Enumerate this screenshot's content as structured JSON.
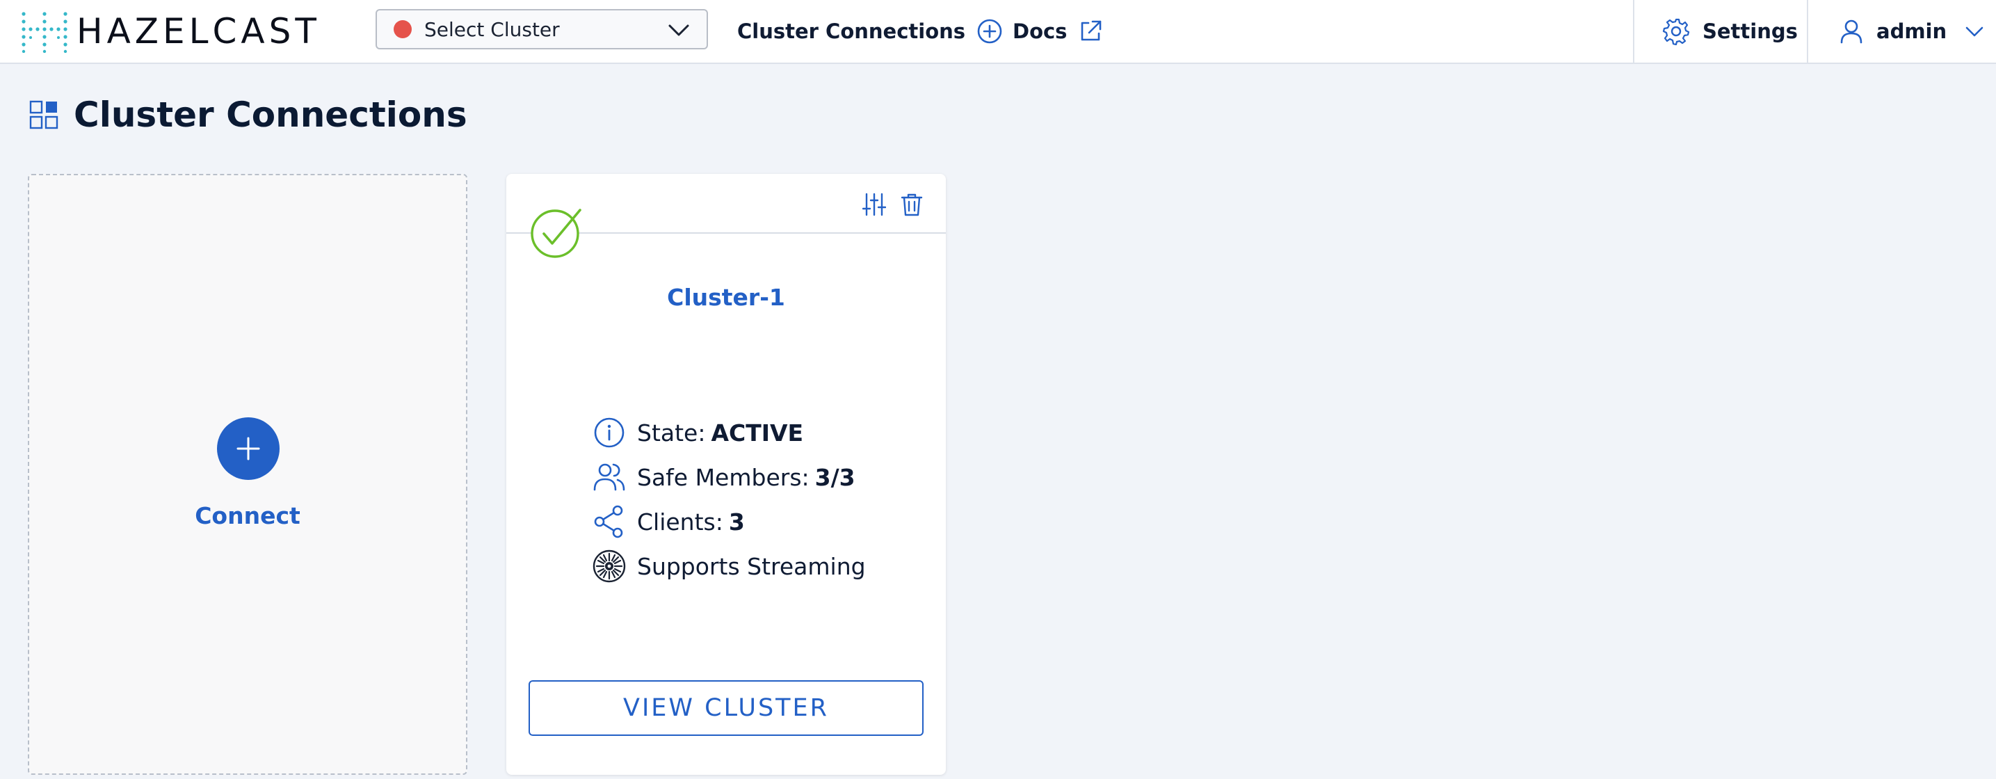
{
  "header": {
    "logo_text": "HAZELCAST",
    "cluster_select": {
      "value": "Select Cluster",
      "status_color": "#e5534b"
    },
    "nav": {
      "cluster_connections": "Cluster Connections",
      "docs": "Docs"
    },
    "settings": "Settings",
    "user": "admin"
  },
  "page": {
    "title": "Cluster Connections"
  },
  "connect_card": {
    "label": "Connect"
  },
  "cluster_card": {
    "name": "Cluster-1",
    "state_label": "State:",
    "state_value": "ACTIVE",
    "members_label": "Safe Members:",
    "members_value": "3/3",
    "clients_label": "Clients:",
    "clients_value": "3",
    "streaming_label": "Supports Streaming",
    "view_button": "VIEW CLUSTER"
  },
  "colors": {
    "accent": "#2360c6",
    "success": "#6bbf2a",
    "logo_teal": "#35b8c9"
  }
}
